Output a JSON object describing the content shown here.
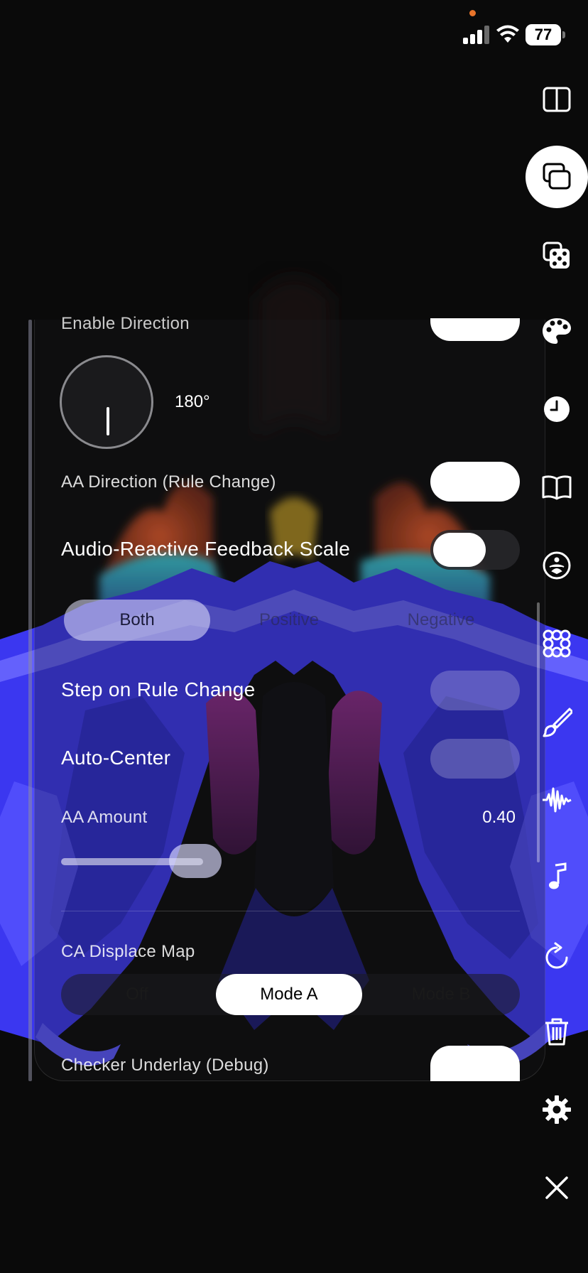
{
  "status_bar": {
    "battery_level": "77",
    "signal": "signal-bars-icon",
    "wifi": "wifi-icon"
  },
  "panel": {
    "enable_direction_label": "Enable Direction",
    "direction_value": "180°",
    "aa_direction_label": "AA Direction (Rule Change)",
    "feedback_scale_label": "Audio-Reactive Feedback Scale",
    "polarity_options": [
      "Both",
      "Positive",
      "Negative"
    ],
    "polarity_selected": "Both",
    "step_on_rule_label": "Step on Rule Change",
    "auto_center_label": "Auto-Center",
    "aa_amount_label": "AA Amount",
    "aa_amount_value": "0.40",
    "aa_amount_fraction": 0.4,
    "ca_displace_label": "CA Displace Map",
    "ca_modes": [
      "Off",
      "Mode A",
      "Mode B"
    ],
    "ca_selected": "Mode A",
    "checker_underlay_label": "Checker Underlay (Debug)"
  },
  "toolbar": {
    "items": [
      "split-view-icon",
      "layers-icon",
      "dice-icon",
      "palette-icon",
      "clock-icon",
      "book-icon",
      "meditation-icon",
      "flower-pattern-icon",
      "brush-icon",
      "waveform-icon",
      "music-note-icon",
      "refresh-icon",
      "trash-icon",
      "gear-icon",
      "close-icon"
    ],
    "active_item": "layers-icon"
  },
  "colors": {
    "background": "#0a0a0a",
    "accent_blue": "#3a36ff",
    "toggle_on": "#ffffff",
    "recording_dot": "#e8742a"
  }
}
